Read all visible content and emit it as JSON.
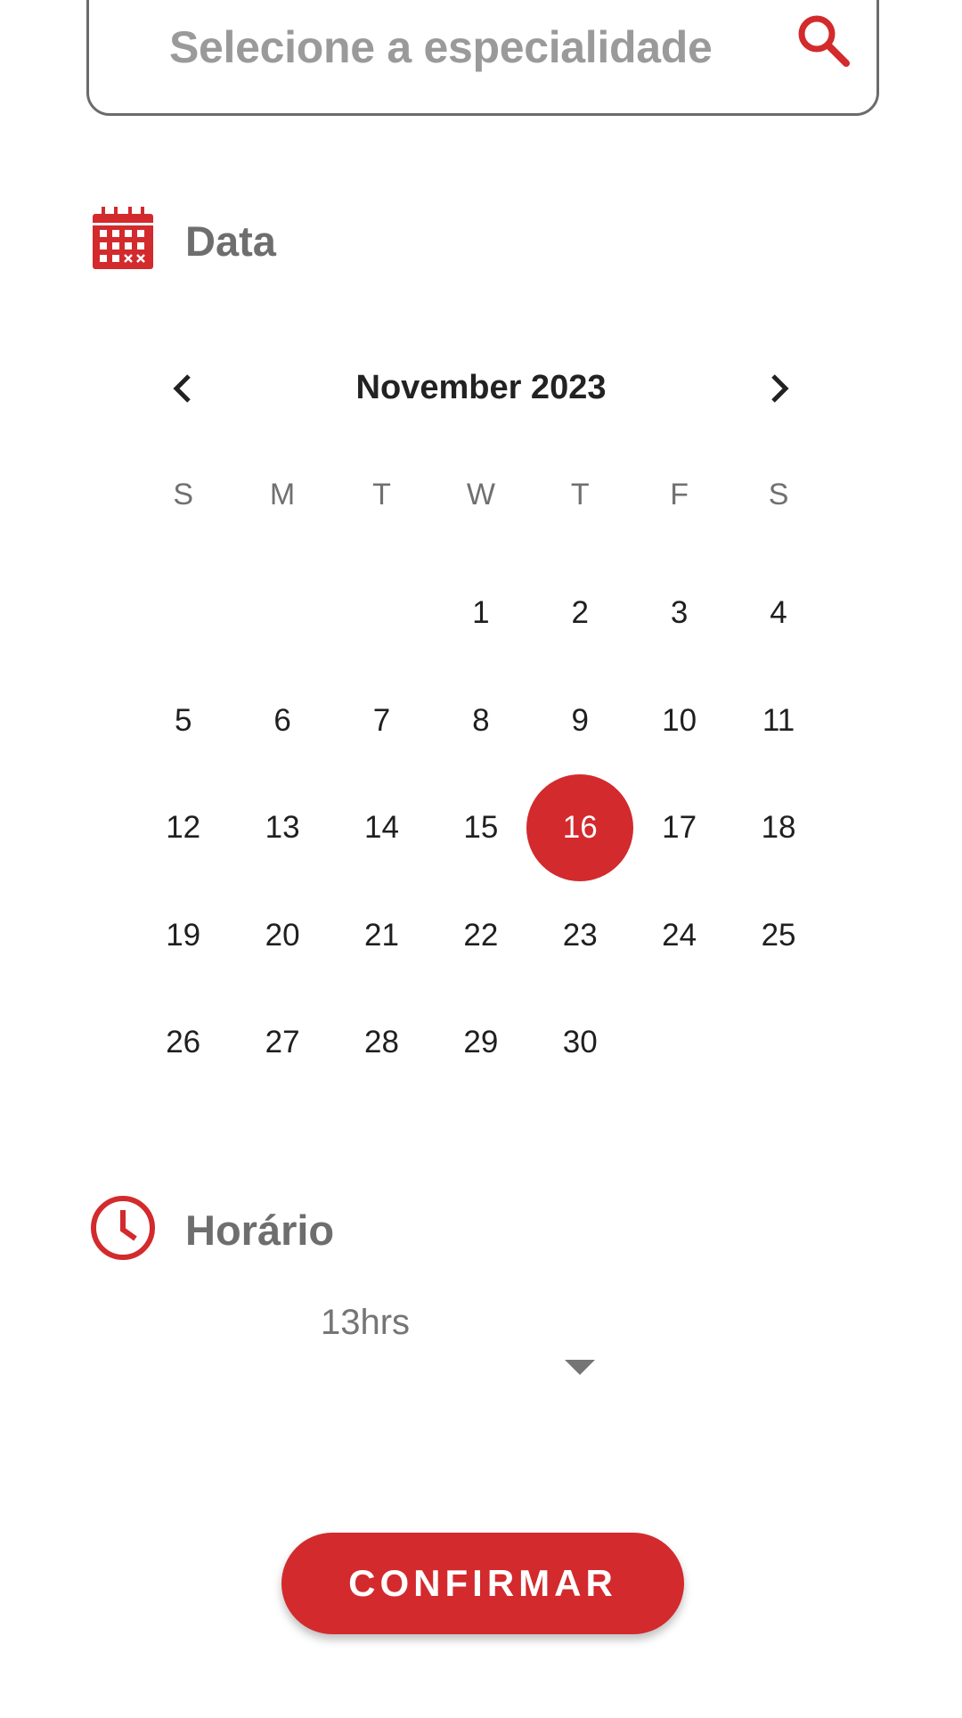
{
  "search": {
    "placeholder": "Selecione a especialidade",
    "icon": "search-icon"
  },
  "date_section": {
    "title": "Data",
    "icon": "calendar-icon"
  },
  "calendar": {
    "month_label": "November 2023",
    "prev_icon": "chevron-left-icon",
    "next_icon": "chevron-right-icon",
    "weekdays": [
      "S",
      "M",
      "T",
      "W",
      "T",
      "F",
      "S"
    ],
    "leading_blanks": 3,
    "days": [
      "1",
      "2",
      "3",
      "4",
      "5",
      "6",
      "7",
      "8",
      "9",
      "10",
      "11",
      "12",
      "13",
      "14",
      "15",
      "16",
      "17",
      "18",
      "19",
      "20",
      "21",
      "22",
      "23",
      "24",
      "25",
      "26",
      "27",
      "28",
      "29",
      "30"
    ],
    "selected_day": "16"
  },
  "time_section": {
    "title": "Horário",
    "icon": "clock-icon",
    "selected_value": "13hrs"
  },
  "confirm": {
    "label": "CONFIRMAR"
  },
  "colors": {
    "accent": "#d32a2d",
    "muted_text": "#6e6e6e",
    "border": "#6b6b6b"
  }
}
